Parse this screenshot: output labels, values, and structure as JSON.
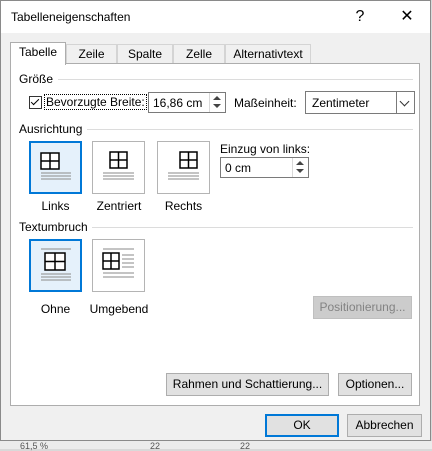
{
  "dialog": {
    "title": "Tabelleneigenschaften",
    "help_glyph": "?",
    "close_glyph": "✕"
  },
  "tabs": [
    {
      "label": "Tabelle",
      "active": true
    },
    {
      "label": "Zeile",
      "active": false
    },
    {
      "label": "Spalte",
      "active": false
    },
    {
      "label": "Zelle",
      "active": false
    },
    {
      "label": "Alternativtext",
      "active": false
    }
  ],
  "size": {
    "heading": "Größe",
    "preferred_width_label": "Bevorzugte Breite:",
    "preferred_width_checked": true,
    "preferred_width_value": "16,86 cm",
    "unit_label": "Maßeinheit:",
    "unit_value": "Zentimeter"
  },
  "alignment": {
    "heading": "Ausrichtung",
    "options": [
      {
        "label": "Links",
        "selected": true,
        "icon": "table-align-left-icon"
      },
      {
        "label": "Zentriert",
        "selected": false,
        "icon": "table-align-center-icon"
      },
      {
        "label": "Rechts",
        "selected": false,
        "icon": "table-align-right-icon"
      }
    ],
    "indent_label": "Einzug von links:",
    "indent_value": "0 cm"
  },
  "text_wrapping": {
    "heading": "Textumbruch",
    "options": [
      {
        "label": "Ohne",
        "selected": true,
        "icon": "wrap-none-icon"
      },
      {
        "label": "Umgebend",
        "selected": false,
        "icon": "wrap-around-icon"
      }
    ],
    "positioning_button": "Positionierung..."
  },
  "buttons": {
    "borders": "Rahmen und Schattierung...",
    "options": "Optionen...",
    "ok": "OK",
    "cancel": "Abbrechen"
  },
  "background_doc": {
    "cells": [
      "61,5 %",
      "22",
      "22"
    ]
  },
  "colors": {
    "accent": "#0078d7",
    "tile_selected_bg": "#e5f1fb",
    "dialog_bg": "#f0f0f0"
  }
}
